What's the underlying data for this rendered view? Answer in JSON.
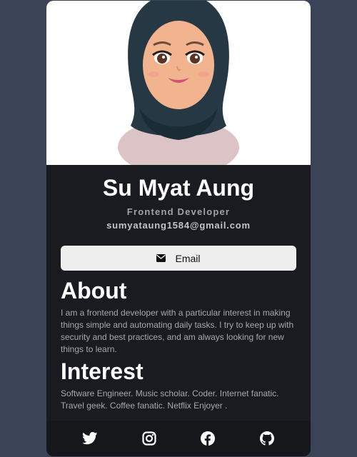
{
  "profile": {
    "name": "Su Myat Aung",
    "role": "Frontend Developer",
    "email": "sumyataung1584@gmail.com"
  },
  "email_button": {
    "label": "Email",
    "icon": "envelope-icon"
  },
  "about": {
    "heading": "About",
    "text": "I am a frontend developer with a particular interest in making things simple and automating daily tasks. I try to keep up with security and best practices, and am always looking for new things to learn."
  },
  "interest": {
    "heading": "Interest",
    "text": "Software Engineer. Music scholar. Coder. Internet fanatic. Travel geek. Coffee fanatic. Netflix Enjoyer ."
  },
  "social": {
    "icons": [
      "twitter-icon",
      "instagram-icon",
      "facebook-icon",
      "github-icon"
    ]
  },
  "colors": {
    "page_background": "#3b4456",
    "card_background": "#1a1b20",
    "footer_background": "#16171b",
    "button_background": "#eeeeee"
  }
}
